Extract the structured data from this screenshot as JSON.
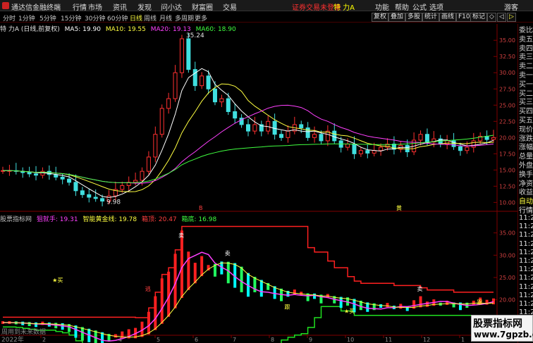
{
  "app": {
    "title": "通达信金融终端",
    "menu": [
      "行情",
      "市场",
      "资讯",
      "发现",
      "问小达",
      "财富圈",
      "交易"
    ],
    "status": "证券交易未登录",
    "stock_short": "特 力A",
    "right_menu": [
      "功能",
      "帮助",
      "公式",
      "选项"
    ],
    "guest": "游客"
  },
  "toolbar": {
    "periods": [
      "分时",
      "1分钟",
      "5分钟",
      "15分钟",
      "30分钟",
      "60分钟",
      "日线",
      "周线",
      "月线",
      "多周期",
      "更多"
    ],
    "active_period": "日线",
    "buttons": [
      "复权",
      "叠加",
      "多股",
      "统计",
      "画线",
      "F10",
      "标记",
      "◇",
      "◁",
      "▷"
    ]
  },
  "main_chart": {
    "title": "特 力A (日线,前复权)",
    "ma": [
      {
        "label": "MA5: 19.90",
        "color": "#ffffff"
      },
      {
        "label": "MA10: 19.55",
        "color": "#ffff40"
      },
      {
        "label": "MA20: 19.13",
        "color": "#ff40ff"
      },
      {
        "label": "MA60: 18.90",
        "color": "#40ff40"
      }
    ],
    "high_label": "35.24",
    "low_label": "9.98",
    "y_ticks": [
      "35.00",
      "32.50",
      "30.00",
      "27.50",
      "25.00",
      "22.50",
      "20.00",
      "17.50",
      "15.00",
      "12.50",
      "10.00"
    ],
    "marker_lower": "B",
    "marker_right": "黄"
  },
  "sub_chart": {
    "title": "股票指标网",
    "items": [
      {
        "label": "狙就手: 19.31",
        "color": "#ff40ff"
      },
      {
        "label": "智能黄金线: 19.78",
        "color": "#ffff40"
      },
      {
        "label": "箱顶: 20.47",
        "color": "#ff4040"
      },
      {
        "label": "箱底: 16.98",
        "color": "#40ff40"
      }
    ],
    "y_ticks": [
      "35.00",
      "30.00",
      "25.00",
      "20.00",
      "15.00"
    ],
    "labels": {
      "buy": "★买",
      "sell": "卖",
      "track": "跟",
      "escape": "逃",
      "chase": "绝佳"
    }
  },
  "side_panel": {
    "items": [
      "委比",
      "卖五",
      "卖四",
      "卖三",
      "卖二",
      "卖一",
      "买一",
      "买二",
      "买三",
      "买四",
      "买五",
      "现价",
      "涨跌",
      "涨幅",
      "总量",
      "外盘",
      "换手",
      "净资",
      "收益",
      "自动",
      "行情",
      "11:26",
      "11:26",
      "11:26",
      "11:26",
      "11:26",
      "11:26",
      "11:26",
      "11:26",
      "11:26",
      "11:26",
      "11:26",
      "11:26",
      "11:26"
    ]
  },
  "x_axis": {
    "year": "2022年",
    "months": [
      "2",
      "3",
      "4",
      "5",
      "6",
      "7",
      "8",
      "9",
      "10",
      "11",
      "12",
      "1"
    ]
  },
  "bottom_note": "周用到未来数据",
  "watermark": {
    "title": "股票指标网",
    "url": "www.7gpzb.com"
  },
  "chart_data": {
    "type": "line",
    "title": "特 力A (日线,前复权)",
    "xlabel": "",
    "ylabel": "",
    "ylim": [
      9.5,
      36
    ],
    "close": [
      14.9,
      14.9,
      14.8,
      14.6,
      14.4,
      14.2,
      14.8,
      14.3,
      13.9,
      13.6,
      13.1,
      11.8,
      11.2,
      10.8,
      10.6,
      10.2,
      11.0,
      12.0,
      12.6,
      13.1,
      13.4,
      14.8,
      17.0,
      20.5,
      24.5,
      26.0,
      30.0,
      35.24,
      30.5,
      28.0,
      29.5,
      27.5,
      25.5,
      26.0,
      24.0,
      23.0,
      22.0,
      21.0,
      22.0,
      21.0,
      22.5,
      20.5,
      20.0,
      21.0,
      22.0,
      21.5,
      20.0,
      20.5,
      19.5,
      21.0,
      19.5,
      18.5,
      19.0,
      17.5,
      18.0,
      17.6,
      18.0,
      18.5,
      19.0,
      18.2,
      18.8,
      17.8,
      19.6,
      20.5,
      19.3,
      19.8,
      19.0,
      19.5,
      18.6,
      18.0,
      18.5,
      19.5,
      20.2,
      19.7,
      20.0
    ]
  }
}
